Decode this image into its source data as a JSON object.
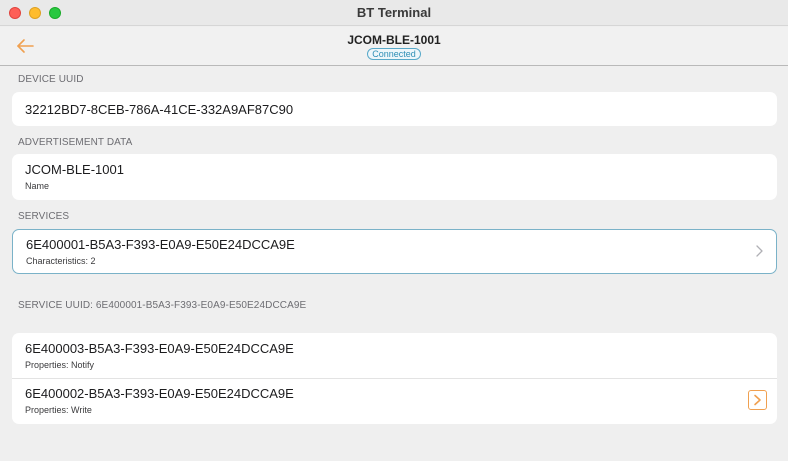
{
  "window": {
    "title": "BT Terminal"
  },
  "nav": {
    "title": "JCOM-BLE-1001",
    "status": "Connected"
  },
  "device_uuid": {
    "header": "DEVICE UUID",
    "value": "32212BD7-8CEB-786A-41CE-332A9AF87C90"
  },
  "advertisement": {
    "header": "ADVERTISEMENT DATA",
    "name_value": "JCOM-BLE-1001",
    "name_label": "Name"
  },
  "services": {
    "header": "SERVICES",
    "items": [
      {
        "uuid": "6E400001-B5A3-F393-E0A9-E50E24DCCA9E",
        "detail": "Characteristics: 2"
      }
    ]
  },
  "service_detail": {
    "header": "SERVICE UUID: 6E400001-B5A3-F393-E0A9-E50E24DCCA9E",
    "characteristics": [
      {
        "uuid": "6E400003-B5A3-F393-E0A9-E50E24DCCA9E",
        "properties": "Properties: Notify"
      },
      {
        "uuid": "6E400002-B5A3-F393-E0A9-E50E24DCCA9E",
        "properties": "Properties: Write"
      }
    ]
  },
  "icons": {
    "back": "arrow-left-icon",
    "chevron": "chevron-right-icon",
    "send": "send-arrow-icon"
  },
  "colors": {
    "accent": "#f0a050",
    "status": "#2f8fb6",
    "background": "#efefef"
  }
}
